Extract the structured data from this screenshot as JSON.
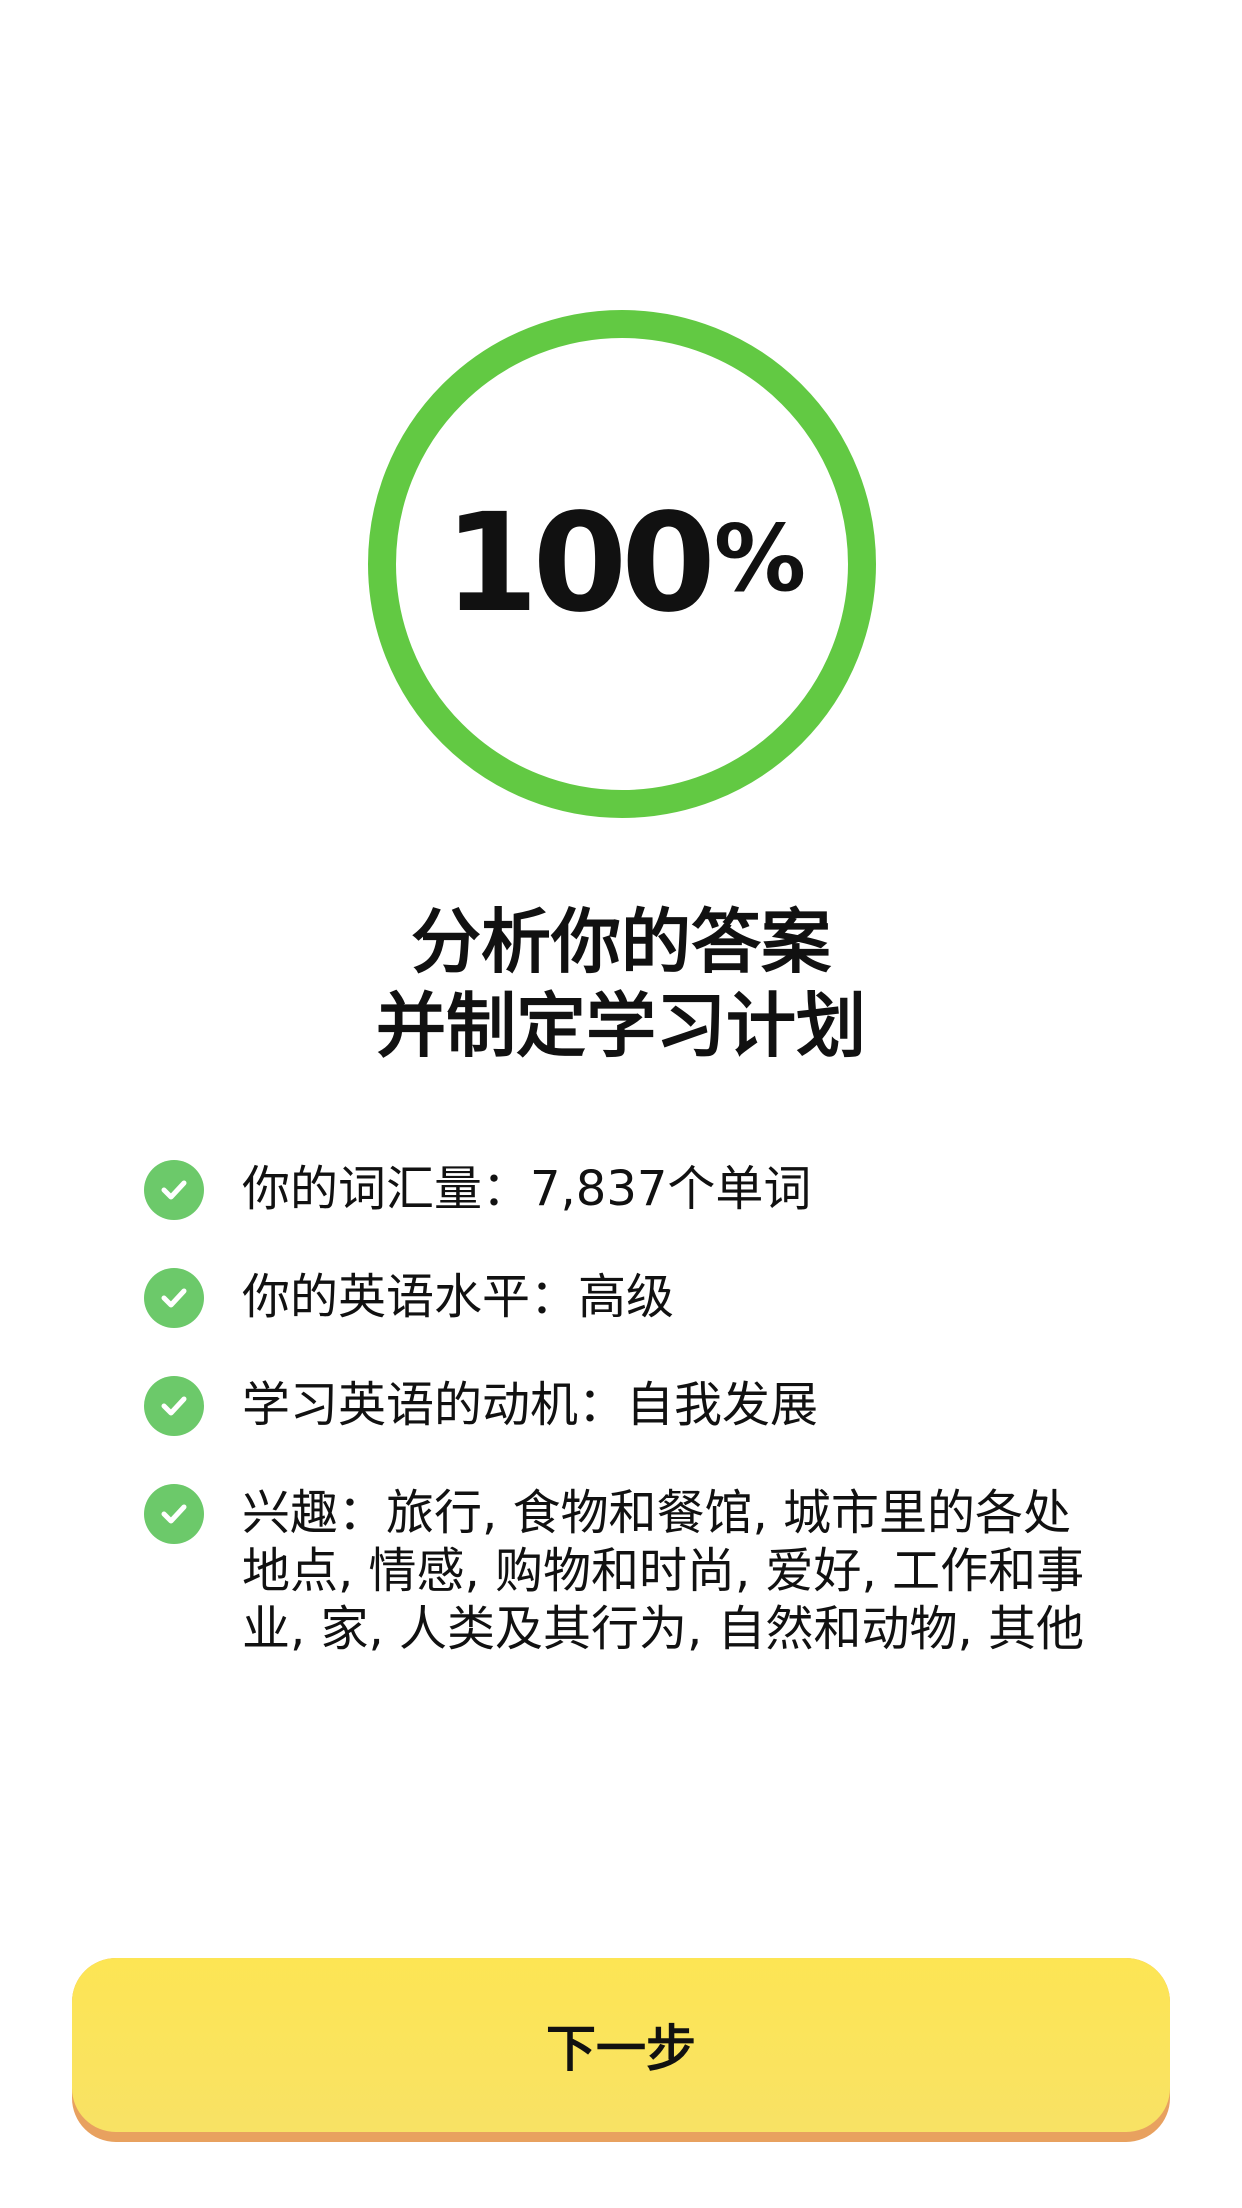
{
  "progress": {
    "value": 100,
    "number_text": "100",
    "percent_sign": "%",
    "ring_color": "#62c943"
  },
  "title": {
    "line1": "分析你的答案",
    "line2": "并制定学习计划"
  },
  "checklist": {
    "icon": "check-circle-icon",
    "icon_color": "#6cc96a",
    "items": [
      {
        "text": "你的词汇量：7,837个单词"
      },
      {
        "text": "你的英语水平：高级"
      },
      {
        "text": "学习英语的动机：自我发展"
      },
      {
        "text": "兴趣：旅行, 食物和餐馆, 城市里的各处地点, 情感, 购物和时尚, 爱好, 工作和事业, 家, 人类及其行为, 自然和动物, 其他"
      }
    ]
  },
  "next_button": {
    "label": "下一步",
    "color": "#fce258",
    "shadow_color": "#e8a15f"
  }
}
